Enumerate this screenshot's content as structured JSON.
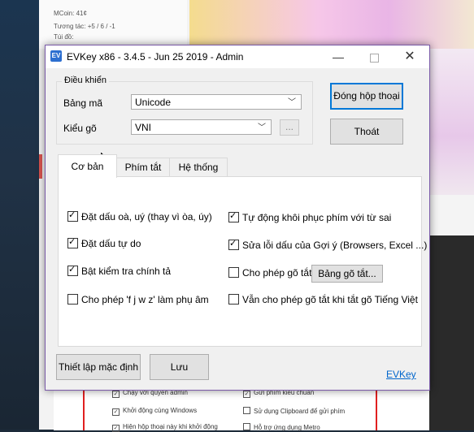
{
  "background": {
    "mcoin_text": "MCoin: 41¢",
    "interaction_text": "Tương tác: +5 / 6 / -1",
    "bag_text": "Túi đồ:",
    "bottom_options": [
      {
        "label": "Chạy với quyền admin",
        "checked": true
      },
      {
        "label": "Gửi phím kiểu chuẩn",
        "checked": true
      },
      {
        "label": "Khởi động cùng Windows",
        "checked": true
      },
      {
        "label": "Sử dụng Clipboard để gửi phím",
        "checked": false
      },
      {
        "label": "Hiện hộp thoại này khi khởi động",
        "checked": true
      },
      {
        "label": "Hỗ trợ ứng dụng Metro",
        "checked": false
      }
    ]
  },
  "dialog": {
    "title": "EVKey x86 - 3.4.5 - Jun 25 2019 - Admin",
    "app_icon": "EV",
    "minimize_glyph": "—",
    "close_glyph": "✕",
    "group_title": "Điều khiển",
    "charset_label": "Bảng mã",
    "charset_value": "Unicode",
    "input_label": "Kiểu gõ",
    "input_value": "VNI",
    "dots_label": "...",
    "dialog_button": "Đóng hộp thoại",
    "exit_button": "Thoát",
    "tabs": [
      {
        "label": "Cơ bản",
        "active": true
      },
      {
        "label": "Phím tắt",
        "active": false
      },
      {
        "label": "Hệ thống",
        "active": false
      }
    ],
    "options": [
      {
        "label": "Đặt dấu oà, uý (thay vì òa, úy)",
        "checked": true
      },
      {
        "label": "Đặt dấu tự do",
        "checked": true
      },
      {
        "label": "Bật kiểm tra chính tả",
        "checked": true
      },
      {
        "label": "Cho phép 'f j w z' làm phụ âm",
        "checked": false
      },
      {
        "label": "Tự động khôi phục phím với từ sai",
        "checked": true
      },
      {
        "label": "Sửa lỗi dấu của Gợi ý (Browsers, Excel ...)",
        "checked": true
      },
      {
        "label": "Cho phép gõ tắt",
        "checked": false
      },
      {
        "label": "Vẫn cho phép gõ tắt khi tắt gõ Tiếng Việt",
        "checked": false
      }
    ],
    "shortcut_table_button": "Bảng gõ tắt...",
    "defaults_button": "Thiết lập mặc định",
    "save_button": "Lưu",
    "link_text": "EVKey"
  }
}
